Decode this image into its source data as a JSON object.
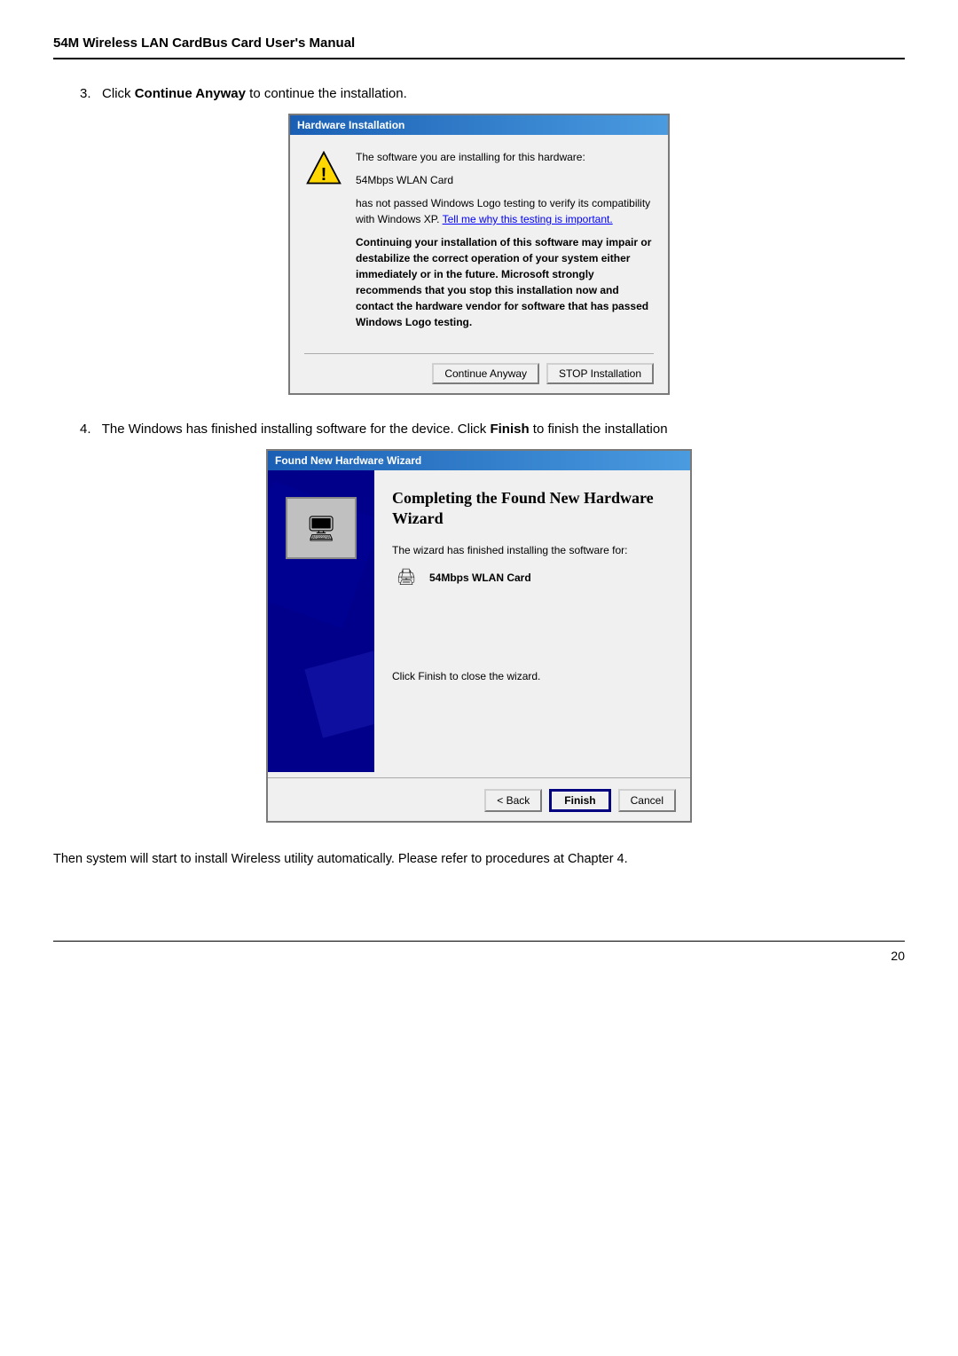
{
  "header": {
    "title": "54M Wireless LAN CardBus Card User's Manual"
  },
  "step3": {
    "number": "3.",
    "text": "Click ",
    "bold": "Continue Anyway",
    "suffix": " to continue the installation.",
    "dialog": {
      "title": "Hardware Installation",
      "line1": "The software you are installing for this hardware:",
      "device": "54Mbps WLAN Card",
      "line2_part1": "has not passed Windows Logo testing to verify its compatibility with Windows XP. ",
      "line2_link": "Tell me why this testing is important.",
      "warning": "Continuing your installation of this software may impair or destabilize the correct operation of your system either immediately or in the future. Microsoft strongly recommends that you stop this installation now and contact the hardware vendor for software that has passed Windows Logo testing.",
      "btn_continue": "Continue Anyway",
      "btn_stop": "STOP Installation"
    }
  },
  "step4": {
    "number": "4.",
    "text_part1": "The Windows has finished installing software for the device. Click ",
    "bold": "Finish",
    "text_part2": " to finish the installation",
    "dialog": {
      "title": "Found New Hardware Wizard",
      "heading": "Completing the Found New Hardware Wizard",
      "subtitle": "The wizard has finished installing the software for:",
      "device": "54Mbps WLAN Card",
      "close_text": "Click Finish to close the wizard.",
      "btn_back": "< Back",
      "btn_finish": "Finish",
      "btn_cancel": "Cancel"
    }
  },
  "paragraph": "Then  system  will  start  to  install  Wireless  utility  automatically.  Please  refer  to procedures at Chapter 4.",
  "footer": {
    "page_number": "20"
  }
}
